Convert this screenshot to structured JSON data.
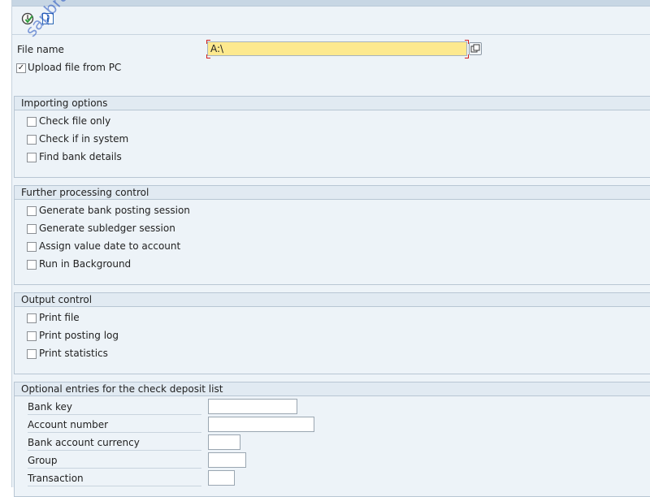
{
  "toolbar": {
    "execute_icon": "execute-icon",
    "info_icon": "info-icon"
  },
  "selection": {
    "file_name_label": "File name",
    "file_name_value": "A:\\",
    "upload_label": "Upload file from PC",
    "upload_checked": true
  },
  "importing": {
    "title": "Importing options",
    "items": [
      {
        "label": "Check file only",
        "checked": false
      },
      {
        "label": "Check if in system",
        "checked": false
      },
      {
        "label": "Find bank details",
        "checked": false
      }
    ]
  },
  "processing": {
    "title": "Further processing control",
    "items": [
      {
        "label": "Generate bank posting session",
        "checked": false
      },
      {
        "label": "Generate subledger session",
        "checked": false
      },
      {
        "label": "Assign value date to account",
        "checked": false
      },
      {
        "label": "Run in Background",
        "checked": false
      }
    ]
  },
  "output": {
    "title": "Output control",
    "items": [
      {
        "label": "Print file",
        "checked": false
      },
      {
        "label": "Print posting log",
        "checked": false
      },
      {
        "label": "Print statistics",
        "checked": false
      }
    ]
  },
  "optional": {
    "title": "Optional entries for the check deposit list",
    "fields": [
      {
        "label": "Bank key",
        "value": ""
      },
      {
        "label": "Account number",
        "value": ""
      },
      {
        "label": "Bank account currency",
        "value": ""
      },
      {
        "label": "Group",
        "value": ""
      },
      {
        "label": "Transaction",
        "value": ""
      }
    ]
  },
  "watermark": "sapbrainsonline.com",
  "colors": {
    "required_field": "#fde98f",
    "background": "#edf3f8",
    "watermark": "#1f4fbf"
  }
}
